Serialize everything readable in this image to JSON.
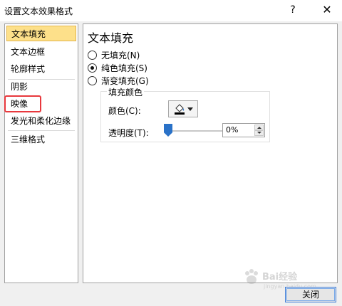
{
  "window": {
    "title": "设置文本效果格式",
    "help_glyph": "?",
    "close_glyph": "✕"
  },
  "sidebar": {
    "items": [
      {
        "label": "文本填充",
        "selected": true
      },
      {
        "label": "文本边框",
        "selected": false
      },
      {
        "label": "轮廓样式",
        "selected": false
      },
      {
        "label": "阴影",
        "selected": false
      },
      {
        "label": "映像",
        "selected": false
      },
      {
        "label": "发光和柔化边缘",
        "selected": false
      },
      {
        "label": "三维格式",
        "selected": false
      }
    ]
  },
  "panel": {
    "title": "文本填充",
    "fill_options": [
      {
        "label": "无填充(N)",
        "checked": false
      },
      {
        "label": "纯色填充(S)",
        "checked": true
      },
      {
        "label": "渐变填充(G)",
        "checked": false
      }
    ],
    "fill_color_group": {
      "title": "填充颜色",
      "color_label": "颜色(C):",
      "color_swatch": "#000000",
      "transparency_label": "透明度(T):",
      "transparency_value": "0%",
      "transparency_fraction": 0
    }
  },
  "footer": {
    "close_label": "关闭"
  },
  "watermark": {
    "brand": "Bai经验",
    "sub": "jingyan.baidu.com"
  },
  "colors": {
    "selection_bg": "#fde08a",
    "highlight_box": "#e8383d",
    "slider_thumb": "#2a72c8",
    "button_focus": "#3c7ddb"
  }
}
